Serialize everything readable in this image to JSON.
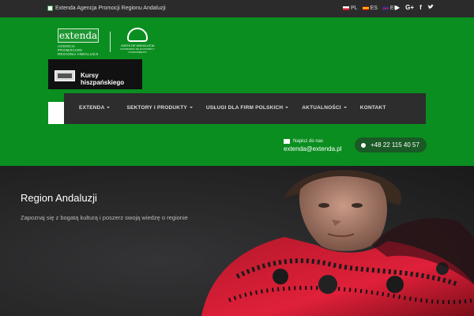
{
  "topbar": {
    "site_name": "Extenda Agencja Promocji Regionu Andaluzji",
    "langs": [
      {
        "code": "PL",
        "flag": "pl"
      },
      {
        "code": "ES",
        "flag": "es"
      },
      {
        "code": "EN",
        "flag": "en"
      }
    ],
    "social": [
      "youtube-icon",
      "google-plus-icon",
      "facebook-icon",
      "twitter-icon"
    ],
    "social_glyphs": [
      "▶",
      "G+",
      "f",
      "🐦"
    ]
  },
  "header": {
    "logo_extenda": "extenda",
    "logo_extenda_sub": "AGENCIA PROMOCION REGIONU ANDALUZJI",
    "logo_junta_title": "JUNTA DE ANDALUCIA",
    "logo_junta_sub": "CONSEJERÍA DE ECONOMÍA Y CONOCIMIENTO",
    "course_label": "Kursy hiszpańskiego",
    "nav": [
      "EXTENDA",
      "SEKTORY I PRODUKTY",
      "USŁUGI DLA FIRM POLSKICH",
      "AKTUALNOŚCI",
      "KONTAKT"
    ],
    "mail_label": "Napisz do nas",
    "mail_value": "extenda@extenda.pl",
    "phone": "+48 22 115 40 57",
    "colors": {
      "green": "#0a8e20",
      "nav": "#2d2d2d",
      "phone_pill": "#1a5a26"
    }
  },
  "hero": {
    "title": "Region Andaluzji",
    "subtitle": "Zapoznaj się z bogatą kulturą i poszerz swoją wiedzę o regionie"
  }
}
